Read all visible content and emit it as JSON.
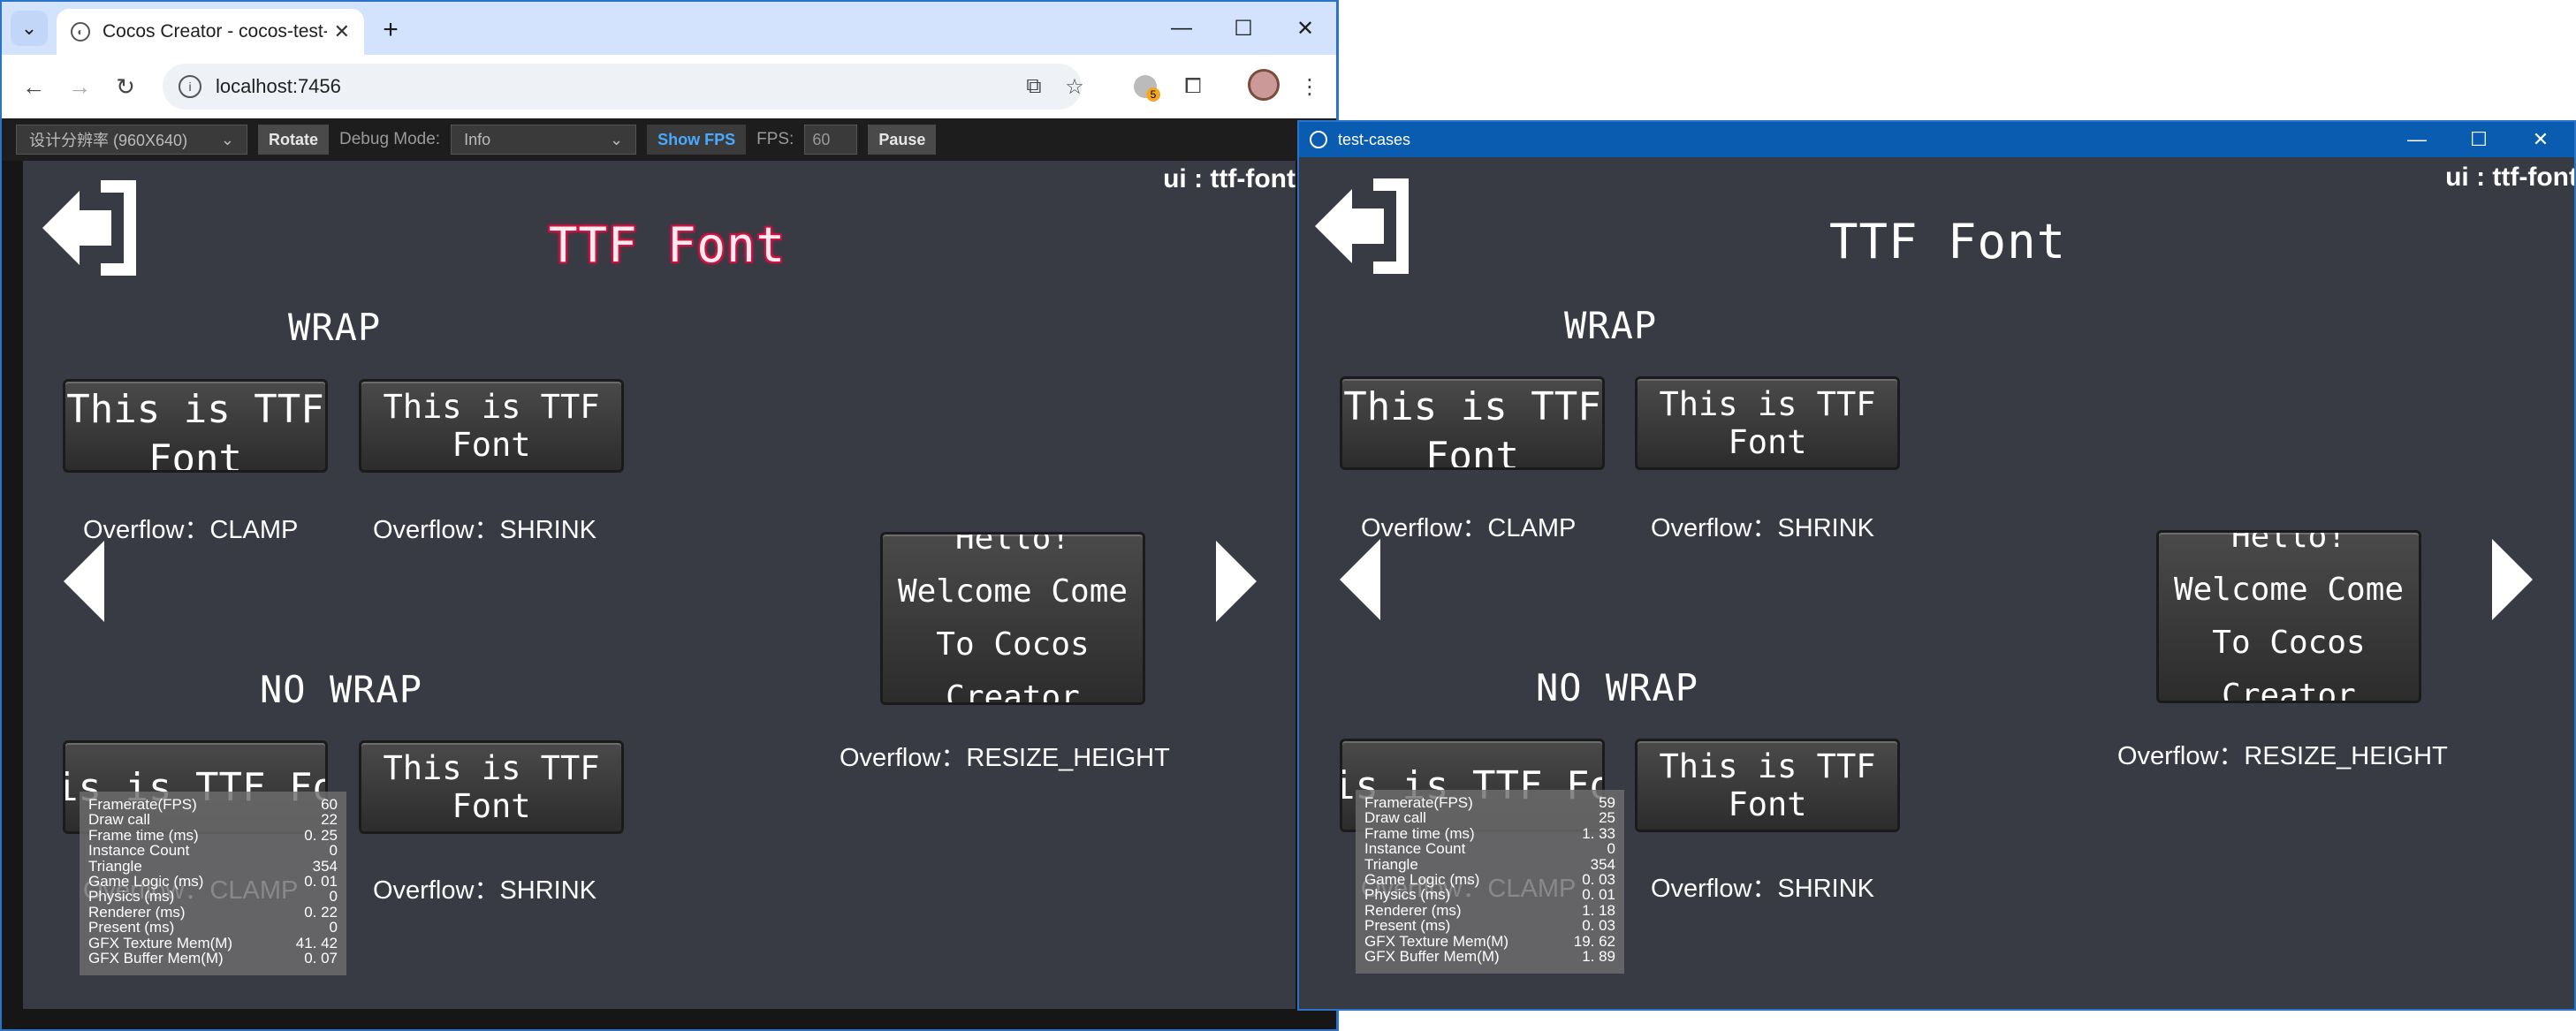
{
  "browser": {
    "tab_title": "Cocos Creator - cocos-test-p",
    "url": "localhost:7456",
    "extension_badge": "5"
  },
  "preview_bar": {
    "resolution": "设计分辨率 (960X640)",
    "rotate": "Rotate",
    "debug_mode_label": "Debug Mode:",
    "debug_mode_value": "Info",
    "show_fps": "Show FPS",
    "fps_label": "FPS:",
    "fps_value": "60",
    "pause": "Pause"
  },
  "scene": {
    "corner_label": "ui : ttf-font",
    "title": "TTF Font",
    "wrap_title": "WRAP",
    "nowrap_title": "NO WRAP",
    "box_clamp_wrap": "This is TTF Font",
    "box_shrink_wrap": "This is TTF Font",
    "box_clamp_nowrap": "This is TTF Font",
    "box_shrink_nowrap": "This is TTF Font",
    "box_resize": "Hello! Welcome Come To Cocos Creator",
    "ovf_clamp": "Overflow：CLAMP",
    "ovf_shrink": "Overflow：SHRINK",
    "ovf_resize": "Overflow：RESIZE_HEIGHT"
  },
  "stats_labels": [
    "Framerate(FPS)",
    "Draw call",
    "Frame time (ms)",
    "Instance Count",
    "Triangle",
    "Game Logic (ms)",
    "Physics (ms)",
    "Renderer (ms)",
    "Present (ms)",
    "GFX Texture Mem(M)",
    "GFX Buffer Mem(M)"
  ],
  "stats_browser": [
    "60",
    "22",
    "0. 25",
    "0",
    "354",
    "0. 01",
    "0",
    "0. 22",
    "0",
    "41. 42",
    "0. 07"
  ],
  "stats_window": [
    "59",
    "25",
    "1. 33",
    "0",
    "354",
    "0. 03",
    "0. 01",
    "1. 18",
    "0. 03",
    "19. 62",
    "1. 89"
  ],
  "window2": {
    "title": "test-cases"
  },
  "colors": {
    "canvas_bg": "#393b44",
    "title_glow": "#e0174a",
    "chrome_accent": "#2a73c9",
    "show_fps_active": "#4aa9ff"
  }
}
